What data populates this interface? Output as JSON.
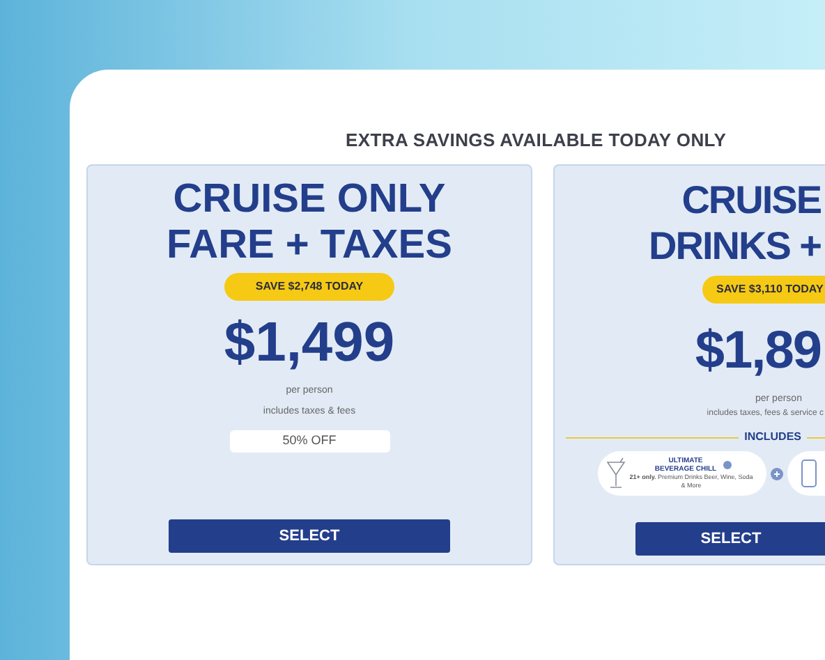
{
  "heading": "EXTRA SAVINGS AVAILABLE TODAY ONLY",
  "cards": [
    {
      "title_lines": [
        "CRUISE ONLY",
        "FARE + TAXES"
      ],
      "savings": "SAVE $2,748 TODAY",
      "price": "$1,499",
      "per": "per person",
      "includes_note": "includes taxes & fees",
      "discount": "50% OFF",
      "button": "SELECT"
    },
    {
      "title_lines": [
        "CRUISE",
        "DRINKS +"
      ],
      "savings": "SAVE $3,110 TODAY",
      "price": "$1,89",
      "per": "per person",
      "includes_note": "includes taxes, fees & service c",
      "includes_label": "INCLUDES",
      "perk": {
        "title": "ULTIMATE BEVERAGE CHILL",
        "age": "21+ only.",
        "desc": "Premium Drinks Beer, Wine, Soda & More"
      },
      "button": "SELECT"
    }
  ]
}
